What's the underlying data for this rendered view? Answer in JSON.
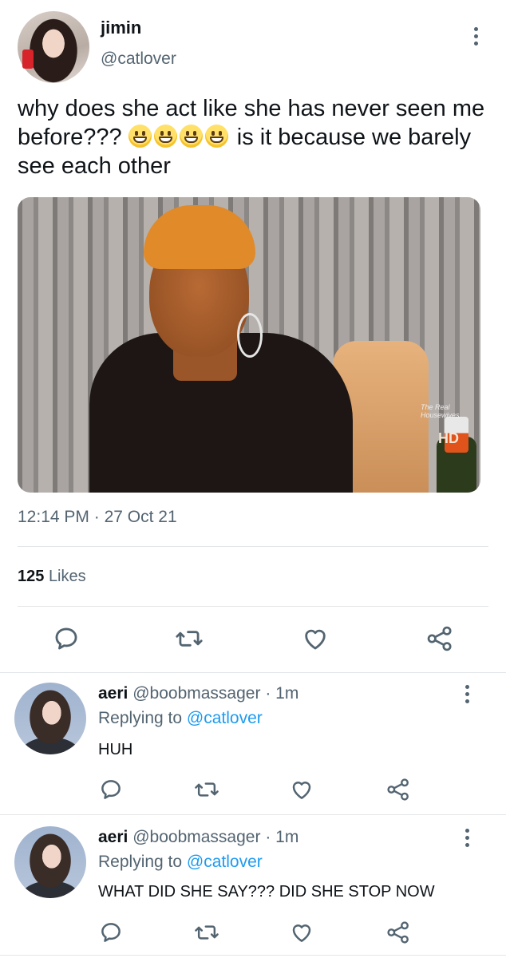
{
  "tweet": {
    "author_name": "jimin",
    "author_handle": "@catlover",
    "text_part1": "why does she act like she has never seen me before???",
    "emojis": [
      "grinning-face-emoji",
      "grinning-face-emoji",
      "grinning-face-emoji",
      "grinning-face-emoji"
    ],
    "text_part2": "is it because we barely see each other",
    "media_watermark": "The Real Housewives",
    "media_hd": "HD",
    "media_channel_number": "6",
    "time": "12:14 PM",
    "date_separator": "·",
    "date": "27 Oct 21",
    "likes_count": "125",
    "likes_label": "Likes",
    "actions": [
      "reply-icon",
      "retweet-icon",
      "like-icon",
      "share-icon"
    ]
  },
  "replies": [
    {
      "author_name": "aeri",
      "author_handle": "@boobmassager",
      "separator": "·",
      "time_ago": "1m",
      "replying_label": "Replying to",
      "replying_handle": "@catlover",
      "text": "HUH"
    },
    {
      "author_name": "aeri",
      "author_handle": "@boobmassager",
      "separator": "·",
      "time_ago": "1m",
      "replying_label": "Replying to",
      "replying_handle": "@catlover",
      "text": "WHAT DID SHE SAY??? DID SHE STOP NOW"
    }
  ],
  "colors": {
    "text": "#0f1419",
    "secondary": "#536471",
    "link": "#1d9bf0",
    "divider": "#e3e6e8"
  }
}
